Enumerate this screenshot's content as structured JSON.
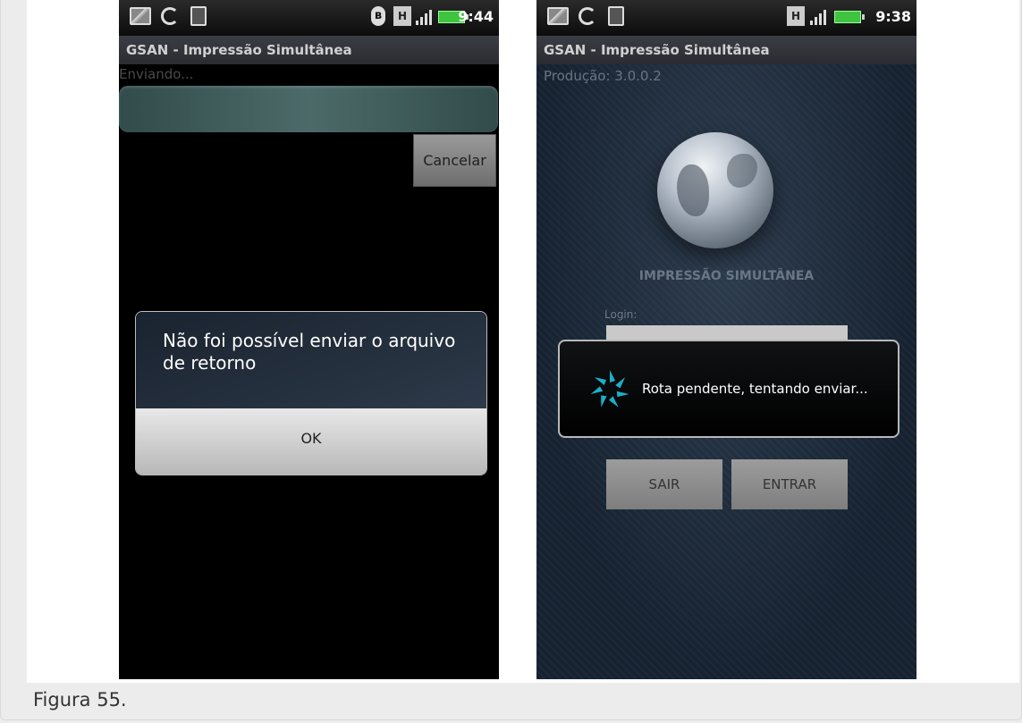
{
  "caption": "Figura 55.",
  "left_screen": {
    "status_time": "9:44",
    "app_title": "GSAN - Impressão Simultânea",
    "sending_label": "Enviando...",
    "cancel_label": "Cancelar",
    "dialog": {
      "message": "Não foi possível enviar o arquivo de retorno",
      "ok_label": "OK"
    }
  },
  "right_screen": {
    "status_time": "9:38",
    "app_title": "GSAN - Impressão Simultânea",
    "version": "Produção: 3.0.0.2",
    "app_name": "IMPRESSÃO SIMULTÂNEA",
    "login_label": "Login:",
    "toast_message": "Rota pendente, tentando enviar...",
    "exit_label": "SAIR",
    "enter_label": "ENTRAR"
  },
  "colors": {
    "progress_fill": "#4c6a69",
    "spinner": "#1ab0c9",
    "battery": "#3ec43e"
  },
  "icons": [
    "picture-icon",
    "sync-icon",
    "usb-icon",
    "bluetooth-icon",
    "hspa-icon",
    "signal-icon",
    "battery-icon",
    "globe-icon",
    "spinner-icon"
  ]
}
